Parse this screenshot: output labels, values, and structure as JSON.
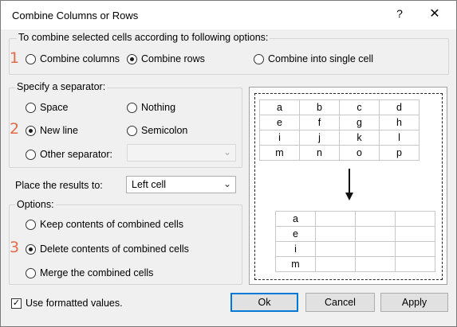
{
  "window": {
    "title": "Combine Columns or Rows",
    "help_glyph": "?",
    "close_glyph": "✕"
  },
  "combine_group": {
    "label": "To combine selected cells according to following options:",
    "options": [
      {
        "label": "Combine columns",
        "selected": false
      },
      {
        "label": "Combine rows",
        "selected": true
      },
      {
        "label": "Combine into single cell",
        "selected": false
      }
    ]
  },
  "separator_group": {
    "label": "Specify a separator:",
    "options": [
      {
        "label": "Space",
        "selected": false
      },
      {
        "label": "Nothing",
        "selected": false
      },
      {
        "label": "New line",
        "selected": true
      },
      {
        "label": "Semicolon",
        "selected": false
      },
      {
        "label": "Other separator:",
        "selected": false
      }
    ],
    "other_value": ""
  },
  "place_results": {
    "label": "Place the results to:",
    "value": "Left cell"
  },
  "options_group": {
    "label": "Options:",
    "options": [
      {
        "label": "Keep contents of combined cells",
        "selected": false
      },
      {
        "label": "Delete contents of combined cells",
        "selected": true
      },
      {
        "label": "Merge the combined cells",
        "selected": false
      }
    ]
  },
  "badges": [
    "1",
    "2",
    "3"
  ],
  "preview": {
    "before": [
      [
        "a",
        "b",
        "c",
        "d"
      ],
      [
        "e",
        "f",
        "g",
        "h"
      ],
      [
        "i",
        "j",
        "k",
        "l"
      ],
      [
        "m",
        "n",
        "o",
        "p"
      ]
    ],
    "after": [
      [
        "a",
        "",
        "",
        ""
      ],
      [
        "e",
        "",
        "",
        ""
      ],
      [
        "i",
        "",
        "",
        ""
      ],
      [
        "m",
        "",
        "",
        ""
      ]
    ]
  },
  "use_formatted": {
    "label": "Use formatted values.",
    "checked": true,
    "mark": "✓"
  },
  "buttons": {
    "ok": "Ok",
    "cancel": "Cancel",
    "apply": "Apply"
  },
  "colors": {
    "badge": "#e46a47",
    "default_button_border": "#0078d7"
  }
}
